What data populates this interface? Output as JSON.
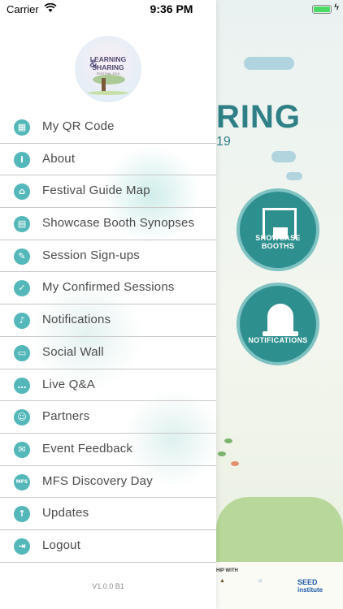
{
  "status_bar": {
    "carrier": "Carrier",
    "time": "9:36 PM",
    "battery_fraction": 1.0,
    "battery_color": "#4cd964"
  },
  "logo": {
    "line1": "LEARNING",
    "amp": "&",
    "line2": "SHARING",
    "line3": "FESTIVAL 2019"
  },
  "menu": {
    "items": [
      {
        "label": "My QR Code",
        "icon": "qr-code-icon",
        "glyph": "▦"
      },
      {
        "label": "About",
        "icon": "info-icon",
        "glyph": "i"
      },
      {
        "label": "Festival Guide Map",
        "icon": "map-icon",
        "glyph": "⌂"
      },
      {
        "label": "Showcase Booth Synopses",
        "icon": "synopsis-icon",
        "glyph": "▤"
      },
      {
        "label": "Session Sign-ups",
        "icon": "signup-icon",
        "glyph": "✎"
      },
      {
        "label": "My Confirmed Sessions",
        "icon": "check-icon",
        "glyph": "✓"
      },
      {
        "label": "Notifications",
        "icon": "bell-icon",
        "glyph": "♪"
      },
      {
        "label": "Social Wall",
        "icon": "wall-icon",
        "glyph": "▭"
      },
      {
        "label": "Live Q&A",
        "icon": "chat-icon",
        "glyph": "…"
      },
      {
        "label": "Partners",
        "icon": "handshake-icon",
        "glyph": "☺"
      },
      {
        "label": "Event Feedback",
        "icon": "feedback-icon",
        "glyph": "✉"
      },
      {
        "label": "MFS Discovery Day",
        "icon": "mfs-icon",
        "glyph": "MFS"
      },
      {
        "label": "Updates",
        "icon": "upload-icon",
        "glyph": "↑"
      },
      {
        "label": "Logout",
        "icon": "logout-icon",
        "glyph": "⇥"
      }
    ]
  },
  "version": "V1.0.0 B1",
  "background_app": {
    "title_fragment": "RING",
    "year_fragment": "19",
    "showcase_label": "SHOWCASE BOOTHS",
    "notifications_label": "NOTIFICATIONS",
    "partners_label": "HIP WITH",
    "partner_seed_line1": "SEED",
    "partner_seed_line2": "institute",
    "accent_color": "#2e8f8f"
  }
}
